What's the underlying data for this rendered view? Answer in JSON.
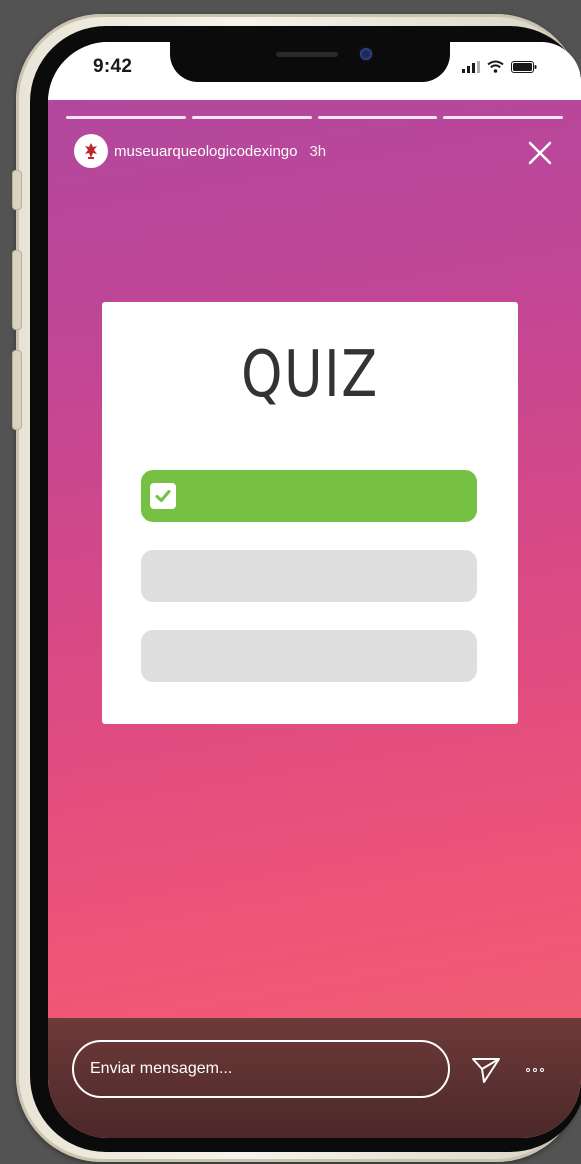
{
  "status_bar": {
    "time": "9:42"
  },
  "story": {
    "progress_segments": 4,
    "username": "museuarqueologicodexingo",
    "age": "3h",
    "avatar_icon": "museum-logo-icon",
    "close_icon": "close-icon"
  },
  "quiz": {
    "title": "QUIZ",
    "options": [
      {
        "state": "correct",
        "icon": "check-icon",
        "color": "#76c043"
      },
      {
        "state": "blank",
        "color": "#dedede"
      },
      {
        "state": "blank",
        "color": "#dedede"
      }
    ]
  },
  "bottom_bar": {
    "message_placeholder": "Enviar mensagem...",
    "send_icon": "paper-plane-icon",
    "more_icon": "more-dots-icon"
  },
  "colors": {
    "gradient_top": "#b2489e",
    "gradient_bottom": "#f06470",
    "correct_green": "#76c043"
  }
}
